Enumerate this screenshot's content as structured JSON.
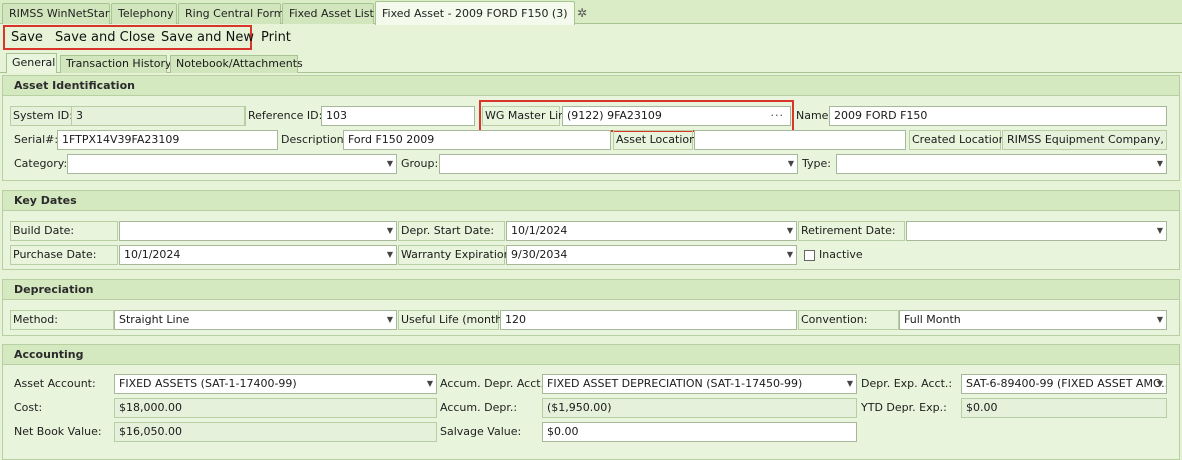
{
  "doc_tabs": [
    {
      "label": "RIMSS WinNetStar"
    },
    {
      "label": "Telephony"
    },
    {
      "label": "Ring Central Form"
    },
    {
      "label": "Fixed Asset List"
    },
    {
      "label": "Fixed Asset - 2009 FORD F150 (3)"
    }
  ],
  "toolbar": {
    "save": "Save",
    "save_close": "Save and Close",
    "save_new": "Save and New",
    "print": "Print"
  },
  "sub_tabs": [
    {
      "label": "General"
    },
    {
      "label": "Transaction History"
    },
    {
      "label": "Notebook/Attachments"
    }
  ],
  "asset_identification": {
    "header": "Asset Identification",
    "system_id_label": "System ID:",
    "system_id": "3",
    "reference_id_label": "Reference ID:",
    "reference_id": "103",
    "wg_master_link_label": "WG Master Link",
    "wg_master_link": "(9122) 9FA23109",
    "name_label": "Name:",
    "name": "2009 FORD F150",
    "serial_label": "Serial#:",
    "serial": "1FTPX14V39FA23109",
    "description_label": "Description:",
    "description": "Ford F150 2009",
    "asset_location_label": "Asset Location:",
    "asset_location": "",
    "created_location_label": "Created Location:",
    "created_location": "RIMSS Equipment Company, Inc.",
    "category_label": "Category:",
    "category": "",
    "group_label": "Group:",
    "group": "",
    "type_label": "Type:",
    "type": ""
  },
  "key_dates": {
    "header": "Key Dates",
    "build_date_label": "Build Date:",
    "build_date": "",
    "depr_start_label": "Depr. Start Date:",
    "depr_start": "10/1/2024",
    "retirement_label": "Retirement Date:",
    "retirement": "",
    "purchase_label": "Purchase Date:",
    "purchase": "10/1/2024",
    "warranty_label": "Warranty Expiration:",
    "warranty": "9/30/2034",
    "inactive_label": "Inactive",
    "inactive": false
  },
  "depreciation": {
    "header": "Depreciation",
    "method_label": "Method:",
    "method": "Straight Line",
    "useful_life_label": "Useful Life (months)",
    "useful_life": "120",
    "convention_label": "Convention:",
    "convention": "Full Month"
  },
  "accounting": {
    "header": "Accounting",
    "asset_account_label": "Asset Account:",
    "asset_account": "FIXED ASSETS (SAT-1-17400-99)",
    "accum_depr_acct_label": "Accum. Depr. Acct.:",
    "accum_depr_acct": "FIXED ASSET DEPRECIATION (SAT-1-17450-99)",
    "depr_exp_acct_label": "Depr. Exp. Acct.:",
    "depr_exp_acct": "SAT-6-89400-99 (FIXED ASSET AMO...",
    "cost_label": "Cost:",
    "cost": "$18,000.00",
    "accum_depr_label": "Accum. Depr.:",
    "accum_depr": "($1,950.00)",
    "ytd_depr_label": "YTD Depr. Exp.:",
    "ytd_depr": "$0.00",
    "nbv_label": "Net Book Value:",
    "nbv": "$16,050.00",
    "salvage_label": "Salvage Value:",
    "salvage": "$0.00"
  },
  "colors": {
    "background": "#e6f3d6",
    "highlight": "#d9352a"
  }
}
